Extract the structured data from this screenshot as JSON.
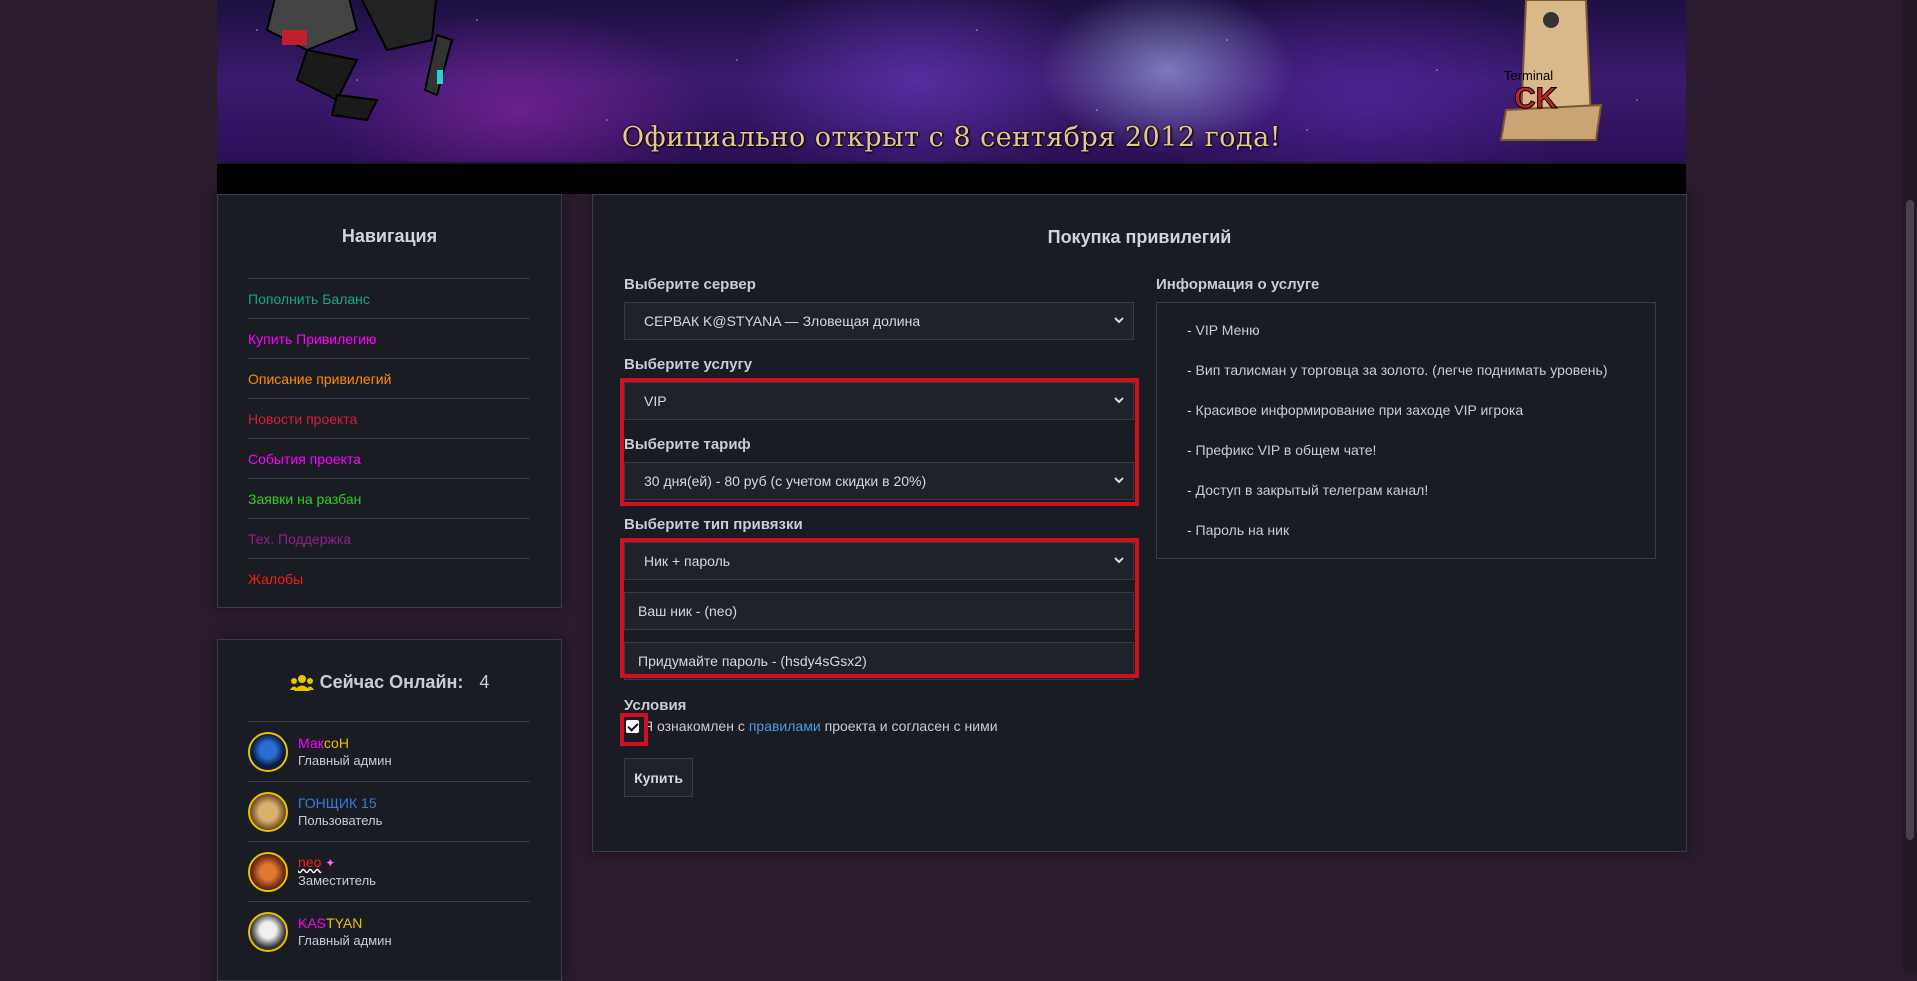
{
  "banner": {
    "tagline": "Официально открыт с 8 сентября 2012 года!",
    "logo_text": "Terminal CK"
  },
  "navigation": {
    "title": "Навигация",
    "items": [
      {
        "label": "Пополнить Баланс",
        "color": "#17a589"
      },
      {
        "label": "Купить Привилегию",
        "color": "#ff00ff"
      },
      {
        "label": "Описание привилегий",
        "color": "#ff8c00"
      },
      {
        "label": "Новости проекта",
        "color": "#d81b3c"
      },
      {
        "label": "События проекта",
        "color": "#ff00ff"
      },
      {
        "label": "Заявки на разбан",
        "color": "#32cd32"
      },
      {
        "label": "Тех. Поддержка",
        "color": "#8e1f8e"
      },
      {
        "label": "Жалобы",
        "color": "#ff1a1a"
      }
    ]
  },
  "online": {
    "title": "Сейчас Онлайн:",
    "count": "4",
    "icon": "users-icon",
    "users": [
      {
        "name_a": "Мак",
        "name_b": "соН",
        "role": "Главный админ"
      },
      {
        "name_a": "ГОНЩИК 15",
        "name_b": "",
        "role": "Пользователь"
      },
      {
        "name_a": "neo",
        "name_b": "",
        "role": "Заместитель"
      },
      {
        "name_a": "KAS",
        "name_b": "TYAN",
        "role": "Главный админ"
      }
    ]
  },
  "purchase": {
    "title": "Покупка привилегий",
    "server_label": "Выберите сервер",
    "server_value": "СЕРВАК K@STYANA — Зловещая долина",
    "service_label": "Выберите услугу",
    "service_value": "VIP",
    "tariff_label": "Выберите тариф",
    "tariff_value": "30 дня(ей) - 80 руб (с учетом скидки в 20%)",
    "binding_label": "Выберите тип привязки",
    "binding_value": "Ник + пароль",
    "nick_field": "Ваш ник - (neo)",
    "password_field": "Придумайте пароль - (hsdy4sGsx2)",
    "terms_label": "Условия",
    "terms_before": "Я ознакомлен с",
    "terms_link": "правилами",
    "terms_after": "проекта и согласен с ними",
    "buy_button": "Купить"
  },
  "info": {
    "title": "Информация о услуге",
    "lines": [
      "- VIP Меню",
      "- Вип талисман у торговца за золото. (легче поднимать уровень)",
      "- Красивое информирование при заходе VIP игрока",
      "- Префикс VIP в общем чате!",
      "- Доступ в закрытый телеграм канал!",
      "- Пароль на ник"
    ]
  },
  "colors": {
    "highlight": "#d0101e",
    "accent_gold": "#e6c200",
    "link": "#4f9be0"
  }
}
